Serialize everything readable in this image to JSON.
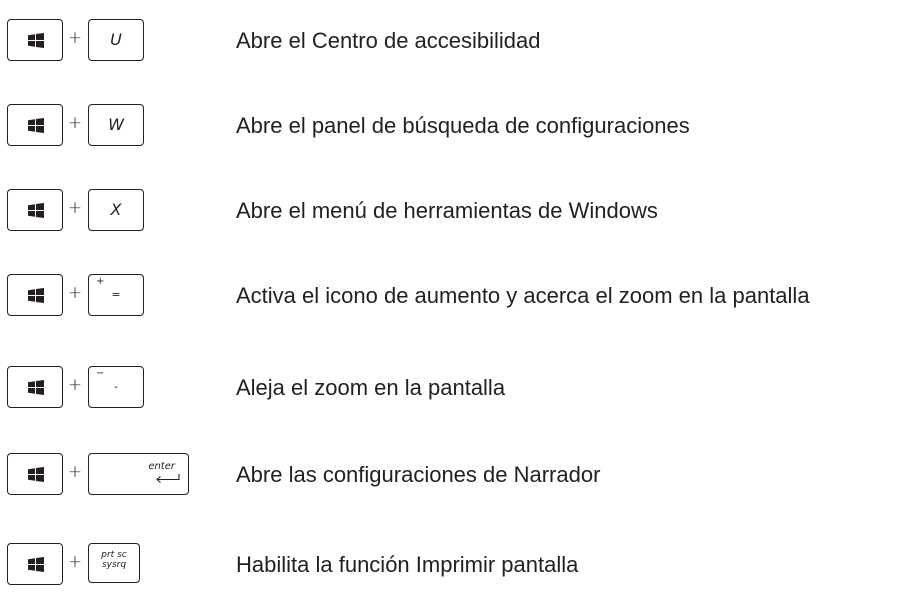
{
  "plus_sign": "+",
  "shortcuts": [
    {
      "key": "U",
      "description": "Abre el Centro de accesibilidad"
    },
    {
      "key": "W",
      "description": "Abre el panel de búsqueda de configuraciones"
    },
    {
      "key": "X",
      "description": "Abre el menú de herramientas de Windows"
    },
    {
      "key_top": "+",
      "key_main": "=",
      "description": "Activa el icono de aumento y acerca el zoom en la pantalla"
    },
    {
      "key_top": "−",
      "key_main": "-",
      "description": "Aleja el zoom en la pantalla"
    },
    {
      "key": "enter",
      "key_icon": "enter-arrow-icon",
      "description": "Abre las configuraciones de Narrador"
    },
    {
      "key_top": "prt sc",
      "key_main": "sysrq",
      "description": "Habilita la función Imprimir pantalla"
    }
  ],
  "modifier_icon": "windows-logo-icon",
  "colors": {
    "text": "#231f20",
    "background": "#ffffff"
  }
}
